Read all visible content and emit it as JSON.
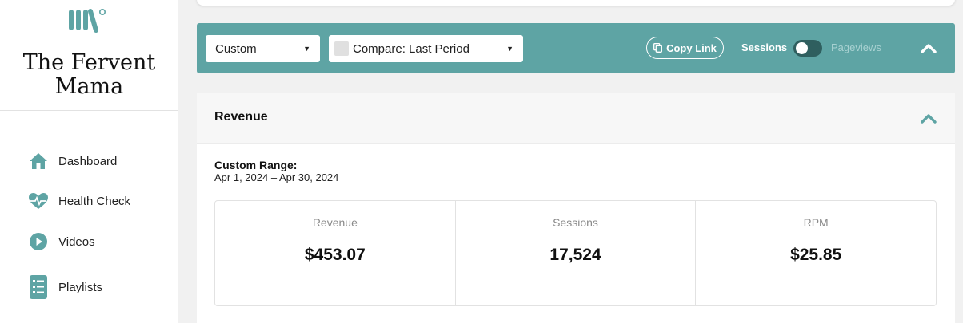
{
  "brand": {
    "name_line1": "The Fervent",
    "name_line2": "Mama",
    "logo_icon": "brand-logo-icon",
    "accent_color": "#5ea4a4"
  },
  "sidebar": {
    "items": [
      {
        "label": "Dashboard",
        "icon": "home-icon"
      },
      {
        "label": "Health Check",
        "icon": "heartbeat-icon"
      },
      {
        "label": "Videos",
        "icon": "play-circle-icon"
      },
      {
        "label": "Playlists",
        "icon": "list-icon"
      }
    ]
  },
  "toolbar": {
    "range_select": "Custom",
    "compare_select": "Compare: Last Period",
    "copy_link_label": "Copy Link",
    "toggle_left_label": "Sessions",
    "toggle_right_label": "Pageviews",
    "toggle_state": "sessions"
  },
  "revenue": {
    "title": "Revenue",
    "range_label": "Custom Range:",
    "range_value": "Apr 1, 2024 – Apr 30, 2024",
    "stats": [
      {
        "label": "Revenue",
        "value": "$453.07"
      },
      {
        "label": "Sessions",
        "value": "17,524"
      },
      {
        "label": "RPM",
        "value": "$25.85"
      }
    ]
  }
}
